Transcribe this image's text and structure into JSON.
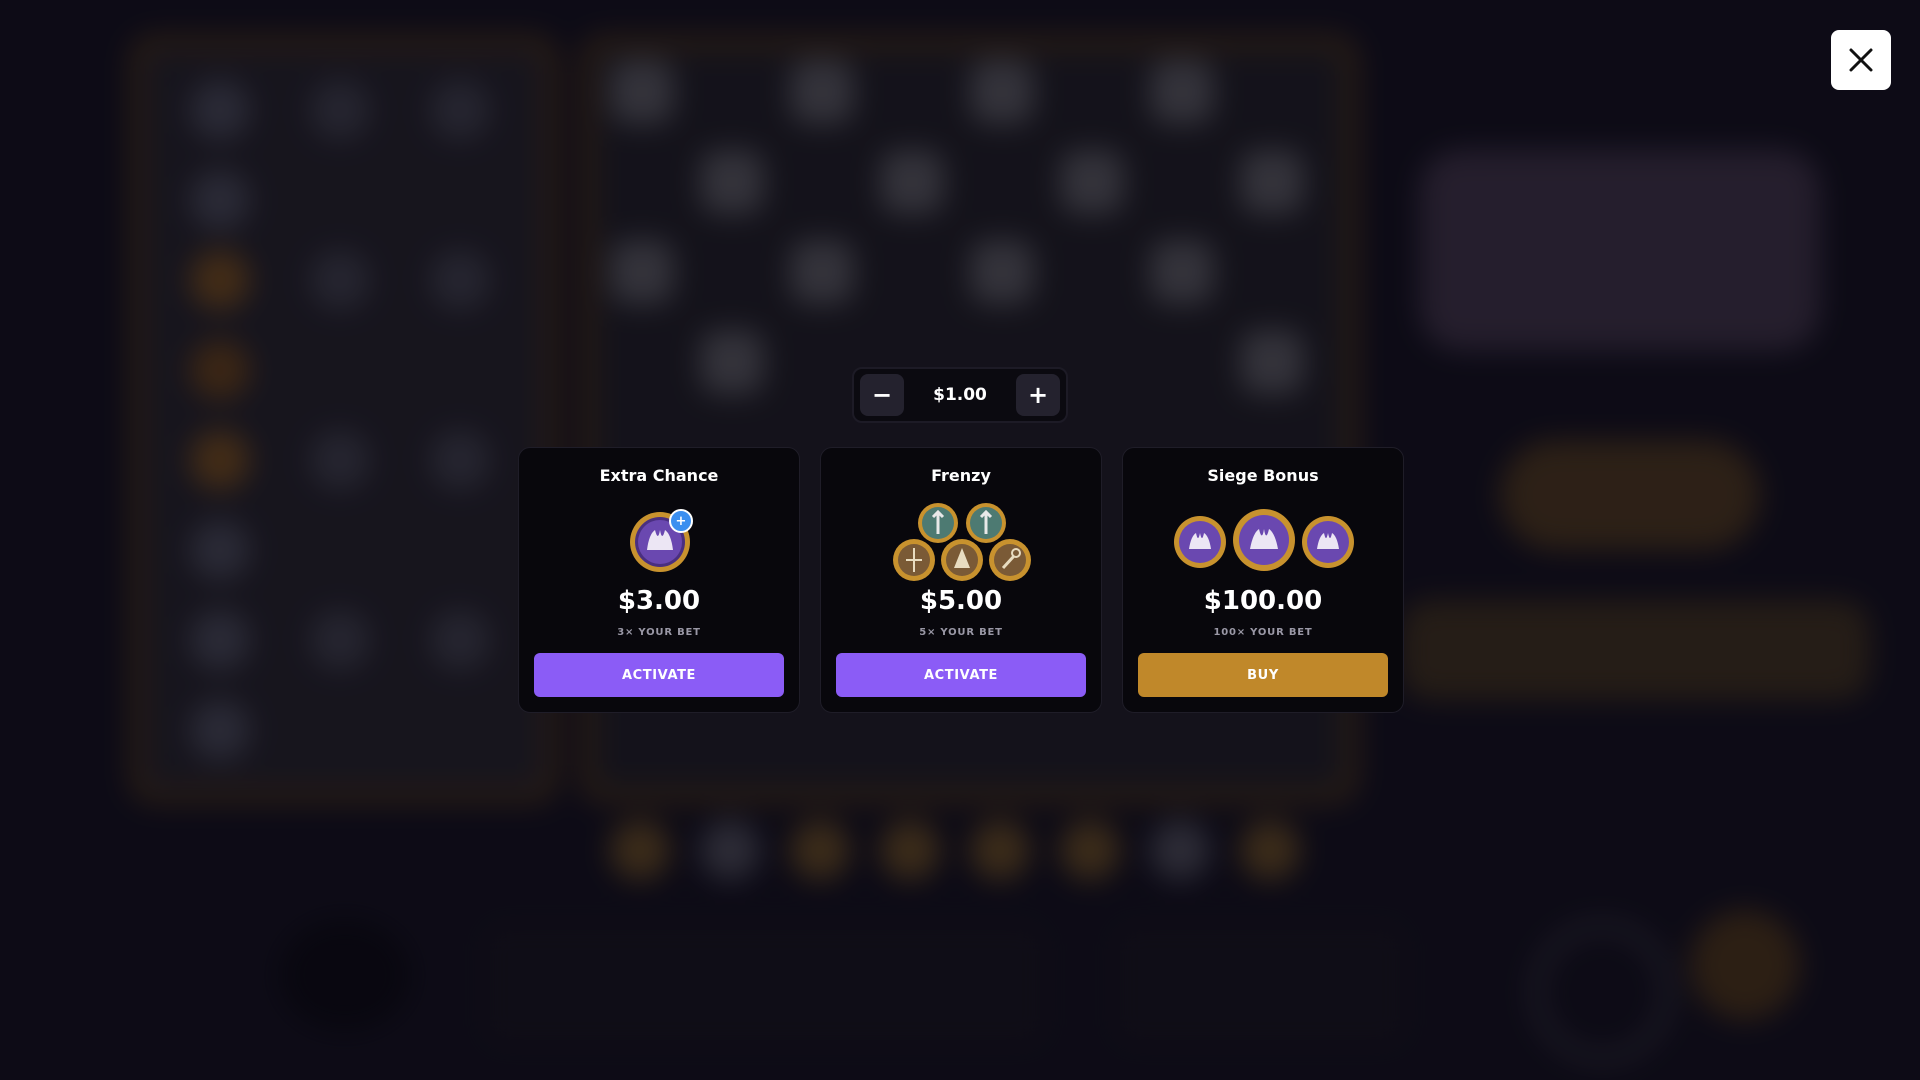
{
  "modal": {
    "close_icon": "close-icon",
    "bet": {
      "value": "$1.00",
      "decrement_label": "−",
      "increment_label": "+"
    },
    "cards": [
      {
        "title": "Extra Chance",
        "price": "$3.00",
        "multiplier": "3× YOUR BET",
        "button": "ACTIVATE",
        "badge": "+",
        "icon": "jester-medal-icon"
      },
      {
        "title": "Frenzy",
        "price": "$5.00",
        "multiplier": "5× YOUR BET",
        "button": "ACTIVATE",
        "icon": "chess-medals-icon"
      },
      {
        "title": "Siege Bonus",
        "price": "$100.00",
        "multiplier": "100× YOUR BET",
        "button": "BUY",
        "icon": "triple-jester-medals-icon"
      }
    ]
  },
  "colors": {
    "accent_purple": "#8b5cf6",
    "accent_gold": "#c0882a",
    "card_bg": "#08070c"
  }
}
